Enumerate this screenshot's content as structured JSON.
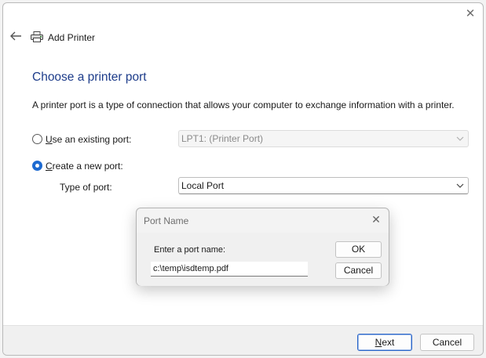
{
  "window": {
    "title": "Add Printer",
    "close_glyph": "✕"
  },
  "page": {
    "heading": "Choose a printer port",
    "description": "A printer port is a type of connection that allows your computer to exchange information with a printer."
  },
  "options": {
    "existing": {
      "label_accel": "U",
      "label_rest": "se an existing port:",
      "selected": false,
      "port_value": "LPT1: (Printer Port)"
    },
    "new": {
      "label_accel": "C",
      "label_rest": "reate a new port:",
      "selected": true,
      "type_label": "Type of port:",
      "type_value": "Local Port"
    }
  },
  "footer": {
    "next_accel": "N",
    "next_rest": "ext",
    "cancel": "Cancel"
  },
  "port_dialog": {
    "title": "Port Name",
    "close_glyph": "✕",
    "prompt": "Enter a port name:",
    "value": "c:\\temp\\isdtemp.pdf",
    "ok": "OK",
    "cancel": "Cancel"
  },
  "colors": {
    "heading": "#1d3c8a",
    "accent": "#1d6ad1"
  },
  "icons": [
    "back-arrow-icon",
    "printer-icon",
    "close-icon",
    "chevron-down-icon"
  ]
}
